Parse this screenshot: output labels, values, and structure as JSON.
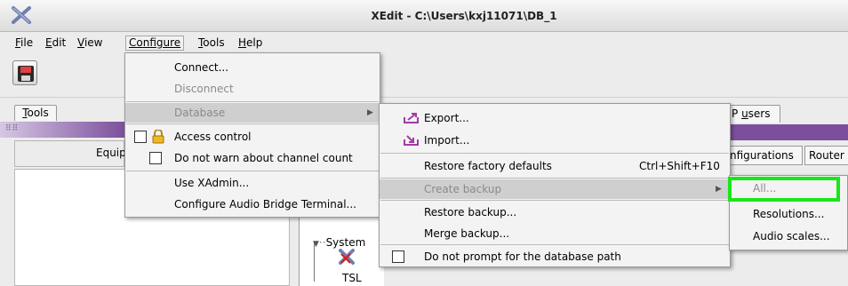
{
  "window": {
    "title": "XEdit - C:\\Users\\kxj11071\\DB_1",
    "logo_icon": "xedit-logo-icon"
  },
  "menubar": {
    "items": [
      {
        "label": "File",
        "u": "F",
        "rest": "ile"
      },
      {
        "label": "Edit",
        "u": "E",
        "rest": "dit"
      },
      {
        "label": "View",
        "u": "V",
        "rest": "iew"
      },
      {
        "label": "Configure",
        "u": "",
        "rest": "Configure"
      },
      {
        "label": "Tools",
        "u": "T",
        "rest": "ools"
      },
      {
        "label": "Help",
        "u": "H",
        "rest": "elp"
      }
    ]
  },
  "toolbar": {
    "save_icon": "save-disk-icon"
  },
  "tools_tab": {
    "label": "Tools",
    "u": "T",
    "rest": "ools"
  },
  "left_panel": {
    "header": "Equip"
  },
  "tree": {
    "system": "System",
    "tsl": "TSL"
  },
  "right_tabs": {
    "p_users": "P users",
    "p_users_pre": "P ",
    "p_users_u": "u",
    "p_users_post": "sers",
    "configurations": "nfigurations",
    "router": "Router"
  },
  "configure_menu": {
    "connect": "Connect...",
    "disconnect": "Disconnect",
    "database": "Database",
    "access_control": "Access control",
    "no_warn_channel": "Do not warn about channel count",
    "use_xadmin": "Use XAdmin...",
    "configure_audio_bridge": "Configure Audio Bridge Terminal..."
  },
  "database_menu": {
    "export": "Export...",
    "import": "Import...",
    "restore_factory": "Restore factory defaults",
    "restore_factory_shortcut": "Ctrl+Shift+F10",
    "create_backup": "Create backup",
    "restore_backup": "Restore backup...",
    "merge_backup": "Merge backup...",
    "no_prompt_path": "Do not prompt for the database path"
  },
  "backup_menu": {
    "all": "All...",
    "resolutions": "Resolutions...",
    "audio_scales": "Audio scales..."
  },
  "colors": {
    "accent_purple": "#7c4f9c",
    "highlight_green": "#19e619",
    "export_icon": "#a43aa4"
  }
}
